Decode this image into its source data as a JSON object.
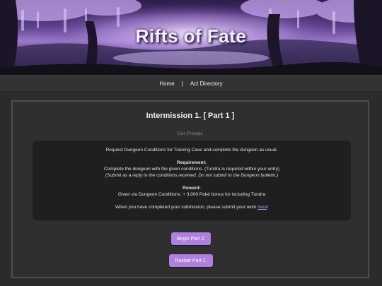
{
  "site": {
    "title": "Rifts of Fate"
  },
  "nav": {
    "home": "Home",
    "separator": "|",
    "act_directory": "Act Directory"
  },
  "panel": {
    "title": "Intermission 1. [ Part 1 ]",
    "subtitle": "Get Prompt.",
    "intro": "Request Dungeon Conditions for Training Cave and complete the dungeon as usual.",
    "requirement_heading": "Requirement:",
    "requirement_text": "Complete the dungeon with the given conditions. (Tundra is required within your entry)",
    "requirement_note": "(Submit as a reply to the conditions received. Do not submit to the Dungeon bulletin.)",
    "reward_heading": "Reward:",
    "reward_text": "Given via Dungeon Conditions. + 3,000 Poké bonus for including Tundra",
    "submit_prefix": "When you have completed your submission, please submit your work ",
    "submit_link": "here",
    "submit_suffix": "!"
  },
  "buttons": {
    "begin": "Begin Part 2.",
    "restart": "Restart Part 1."
  },
  "colors": {
    "accent": "#b07fdf",
    "link": "#b58cf0",
    "background": "#2b2b2b",
    "panel": "#2f2f2f",
    "info_box": "#1f1f1f"
  }
}
